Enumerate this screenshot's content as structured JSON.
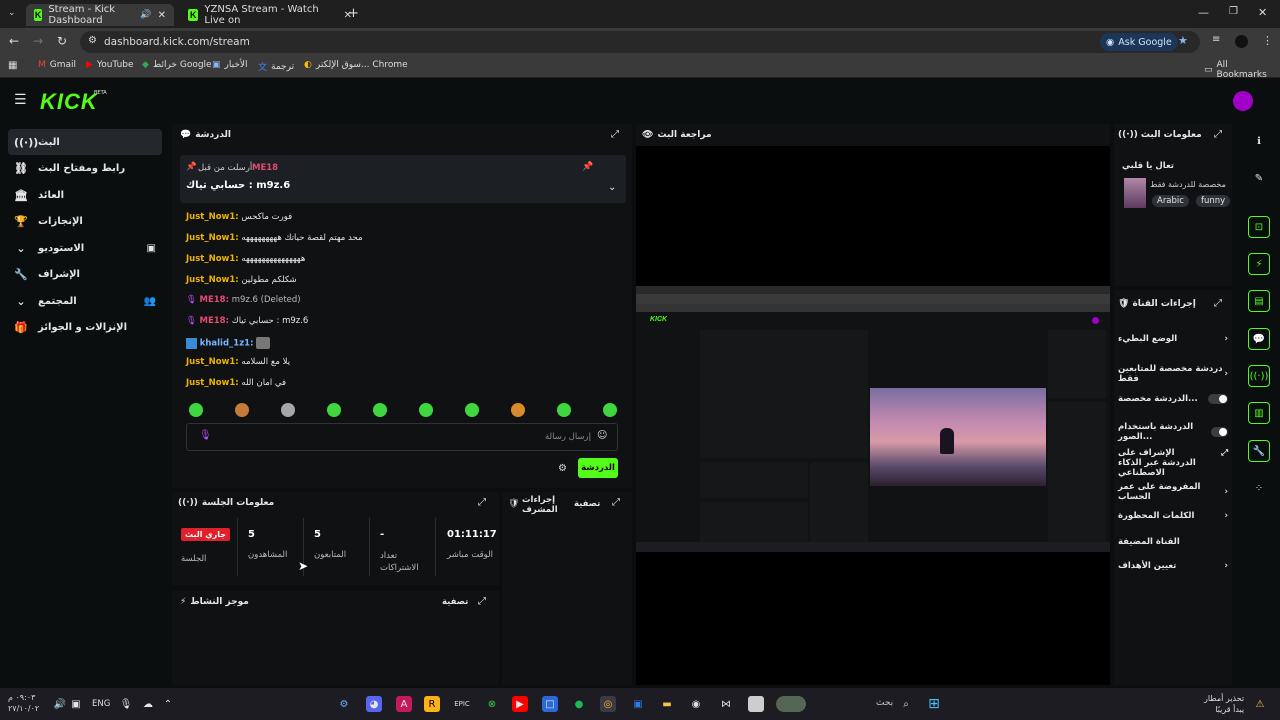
{
  "browser": {
    "tabs": [
      {
        "title": "Stream - Kick Dashboard",
        "active": true
      },
      {
        "title": "YZNSA Stream - Watch Live on",
        "active": false
      }
    ],
    "url": "dashboard.kick.com/stream",
    "ask_google": "Ask Google",
    "bookmarks": [
      "Gmail",
      "YouTube",
      "خرائط Google",
      "الأخبار",
      "ترجمة",
      "سوق الإلكتر... Chrome"
    ],
    "all_bookmarks": "All Bookmarks"
  },
  "app": {
    "logo": "KICK",
    "logo_badge": "BETA",
    "accent": "#53fc18"
  },
  "nav": {
    "items": [
      {
        "label": "البث",
        "icon": "broadcast-icon",
        "active": true
      },
      {
        "label": "رابط ومفتاح البث",
        "icon": "link-icon"
      },
      {
        "label": "العائد",
        "icon": "bank-icon"
      },
      {
        "label": "الإنجازات",
        "icon": "trophy-icon"
      },
      {
        "label": "الاستوديو",
        "icon": "chevron-icon"
      },
      {
        "label": "الإشراف",
        "icon": "wrench-icon"
      },
      {
        "label": "المجتمع",
        "icon": "chevron-icon"
      },
      {
        "label": "الإنزالات و الجوائز",
        "icon": "gift-icon"
      }
    ]
  },
  "chat": {
    "title": "الدردشة",
    "pinned_label": "أرسلت من قبل",
    "pinned_user": "ME18",
    "pinned_message": "حسابي تياك : m9z.6",
    "messages": [
      {
        "user": "Just_Now1:",
        "text": "فورت ماكحس",
        "type": "u"
      },
      {
        "user": "Just_Now1:",
        "text": "محد مهتم لقصة حياتك هههههههههه",
        "type": "u"
      },
      {
        "user": "Just_Now1:",
        "text": "هههههههههههههههه",
        "type": "u"
      },
      {
        "user": "Just_Now1:",
        "text": "شكلكم مطولين",
        "type": "u"
      },
      {
        "user": "ME18:",
        "text": "m9z.6 (Deleted)",
        "type": "m"
      },
      {
        "user": "ME18:",
        "text": "حسابي تياك : m9z.6",
        "type": "m"
      },
      {
        "user": "khalid_1z1:",
        "text": "",
        "type": "k"
      },
      {
        "user": "Just_Now1:",
        "text": "يلا مع السلامه",
        "type": "u"
      },
      {
        "user": "Just_Now1:",
        "text": "في امان الله",
        "type": "u"
      }
    ],
    "input_placeholder": "إرسال رسالة",
    "send_label": "الدردشة"
  },
  "preview": {
    "title": "مراجعة البث"
  },
  "session": {
    "title": "معلومات الجلسة",
    "live_badge": "جاري البث",
    "session_label": "الجلسة",
    "viewers_value": "5",
    "viewers_label": "المشاهدون",
    "followers_value": "5",
    "followers_label": "المتابعون",
    "subs_value": "-",
    "subs_label": "تعداد الاشتراكات",
    "uptime_value": "01:11:17",
    "uptime_label": "الوقت مباشر"
  },
  "mod_actions": {
    "title": "إجراءات المشرف",
    "filter": "تصفية"
  },
  "activity": {
    "title": "موجز النشاط",
    "filter": "تصفية"
  },
  "stream_info": {
    "title": "معلومات البث",
    "stream_title": "تعال يا قلبي",
    "subtitle": "مخصصة للدردشة فقط",
    "tags": [
      "Arabic",
      "funny"
    ]
  },
  "channel_actions": {
    "title": "إجراءات القناة",
    "items": [
      {
        "label": "الوضع البطيء",
        "control": "chevron"
      },
      {
        "label": "دردشة مخصصة للمتابعين فقط",
        "control": "chevron"
      },
      {
        "label": "الدردشة مخصصة...",
        "control": "toggle"
      },
      {
        "label": "الدردشة باستخدام الصور...",
        "control": "toggle"
      },
      {
        "label": "الإشراف على الدردشة عبر الذكاء الاصطناعي",
        "control": "external"
      },
      {
        "label": "المفروضة على عمر الحساب",
        "control": "chevron"
      },
      {
        "label": "الكلمات المحظورة",
        "control": "chevron"
      },
      {
        "label": "القناة المضيفة",
        "control": "none"
      },
      {
        "label": "تعيين الأهداف",
        "control": "chevron"
      }
    ]
  },
  "taskbar": {
    "time": "٠٩:٠٣ م",
    "date": "٢٧/١٠/٠٢",
    "lang": "ENG",
    "search_placeholder": "بحث",
    "weather_line1": "تحذير أمطار",
    "weather_line2": "يبدأ قريبًا"
  }
}
